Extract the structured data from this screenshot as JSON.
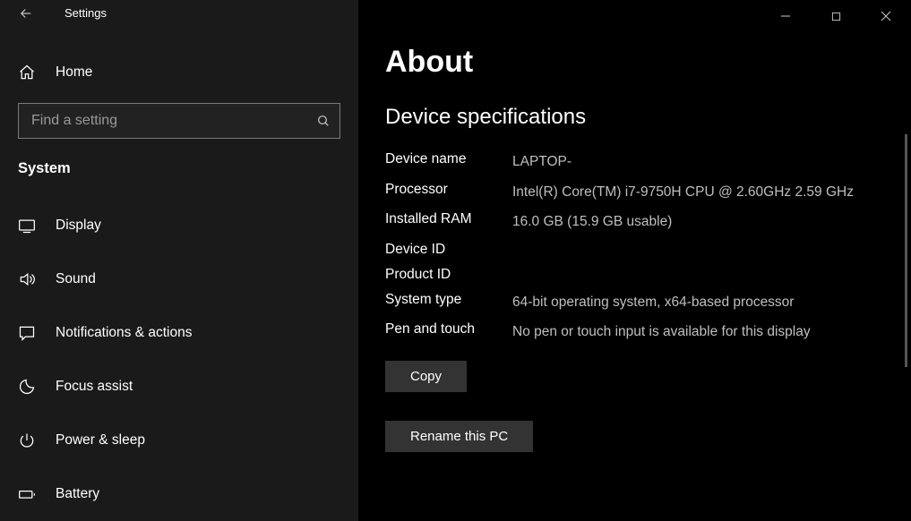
{
  "window": {
    "title": "Settings"
  },
  "sidebar": {
    "home_label": "Home",
    "search_placeholder": "Find a setting",
    "category": "System",
    "items": [
      {
        "icon": "display",
        "label": "Display"
      },
      {
        "icon": "sound",
        "label": "Sound"
      },
      {
        "icon": "notifications",
        "label": "Notifications & actions"
      },
      {
        "icon": "focus",
        "label": "Focus assist"
      },
      {
        "icon": "power",
        "label": "Power & sleep"
      },
      {
        "icon": "battery",
        "label": "Battery"
      }
    ]
  },
  "main": {
    "page_title": "About",
    "section_title": "Device specifications",
    "specs": [
      {
        "label": "Device name",
        "value": "LAPTOP-"
      },
      {
        "label": "Processor",
        "value": "Intel(R) Core(TM) i7-9750H CPU @ 2.60GHz   2.59 GHz"
      },
      {
        "label": "Installed RAM",
        "value": "16.0 GB (15.9 GB usable)"
      },
      {
        "label": "Device ID",
        "value": ""
      },
      {
        "label": "Product ID",
        "value": ""
      },
      {
        "label": "System type",
        "value": "64-bit operating system, x64-based processor"
      },
      {
        "label": "Pen and touch",
        "value": "No pen or touch input is available for this display"
      }
    ],
    "copy_label": "Copy",
    "rename_label": "Rename this PC"
  }
}
